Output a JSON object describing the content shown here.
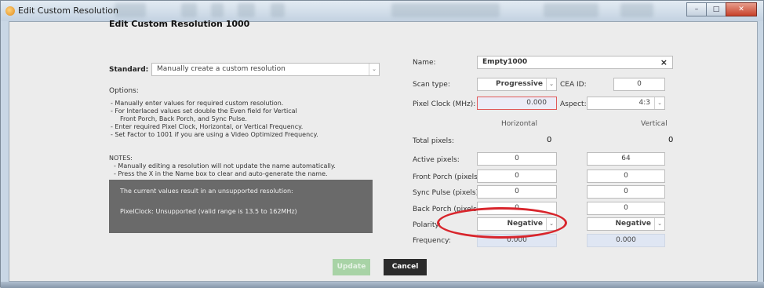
{
  "window": {
    "title": "Edit Custom Resolution",
    "min": "–",
    "max": "□",
    "close": "✕"
  },
  "dialog": {
    "title": "Edit Custom Resolution 1000"
  },
  "standard": {
    "label": "Standard:",
    "value": "Manually create a custom resolution",
    "arrow": "⌄"
  },
  "options": {
    "label": "Options:",
    "lines": [
      "- Manually enter values for required custom resolution.",
      "- For Interlaced values set double the Even field for Vertical",
      "  Front Porch, Back Porch, and Sync Pulse.",
      "- Enter required Pixel Clock, Horizontal, or Vertical Frequency.",
      "- Set Factor to 1001 if you are using a Video Optimized Frequency."
    ],
    "notes_label": "NOTES:",
    "notes": [
      "- Manually editing a resolution will not update the name automatically.",
      "- Press the X in the Name box to clear and auto-generate the name."
    ]
  },
  "warning": {
    "line1": "The current values result in an unsupported resolution:",
    "line2": "PixelClock: Unsupported (valid range is 13.5 to 162MHz)"
  },
  "name": {
    "label": "Name:",
    "value": "Empty1000",
    "clear": "×"
  },
  "scan_type": {
    "label": "Scan type:",
    "value": "Progressive",
    "arrow": "⌄"
  },
  "cea_id": {
    "label": "CEA ID:",
    "value": "0"
  },
  "pixel_clock": {
    "label": "Pixel Clock (MHz):",
    "value": "0.000"
  },
  "aspect": {
    "label": "Aspect:",
    "value": "4:3",
    "arrow": "⌄"
  },
  "columns": {
    "horizontal": "Horizontal",
    "vertical": "Vertical"
  },
  "rows": {
    "total": {
      "label": "Total pixels:",
      "h": "0",
      "v": "0"
    },
    "active": {
      "label": "Active pixels:",
      "h": "0",
      "v": "64"
    },
    "front_porch": {
      "label": "Front Porch (pixels):",
      "h": "0",
      "v": "0"
    },
    "sync_pulse": {
      "label": "Sync Pulse (pixels):",
      "h": "0",
      "v": "0"
    },
    "back_porch": {
      "label": "Back Porch (pixels):",
      "h": "0",
      "v": "0"
    },
    "polarity": {
      "label": "Polarity:",
      "h": "Negative",
      "v": "Negative",
      "arrow": "⌄"
    },
    "frequency": {
      "label": "Frequency:",
      "h": "0.000",
      "v": "0.000"
    }
  },
  "buttons": {
    "update": "Update",
    "cancel": "Cancel"
  },
  "colors": {
    "highlight_ellipse": "#d8252c",
    "error_field_border": "#e05a5a",
    "update_button": "#a8d3a6"
  }
}
